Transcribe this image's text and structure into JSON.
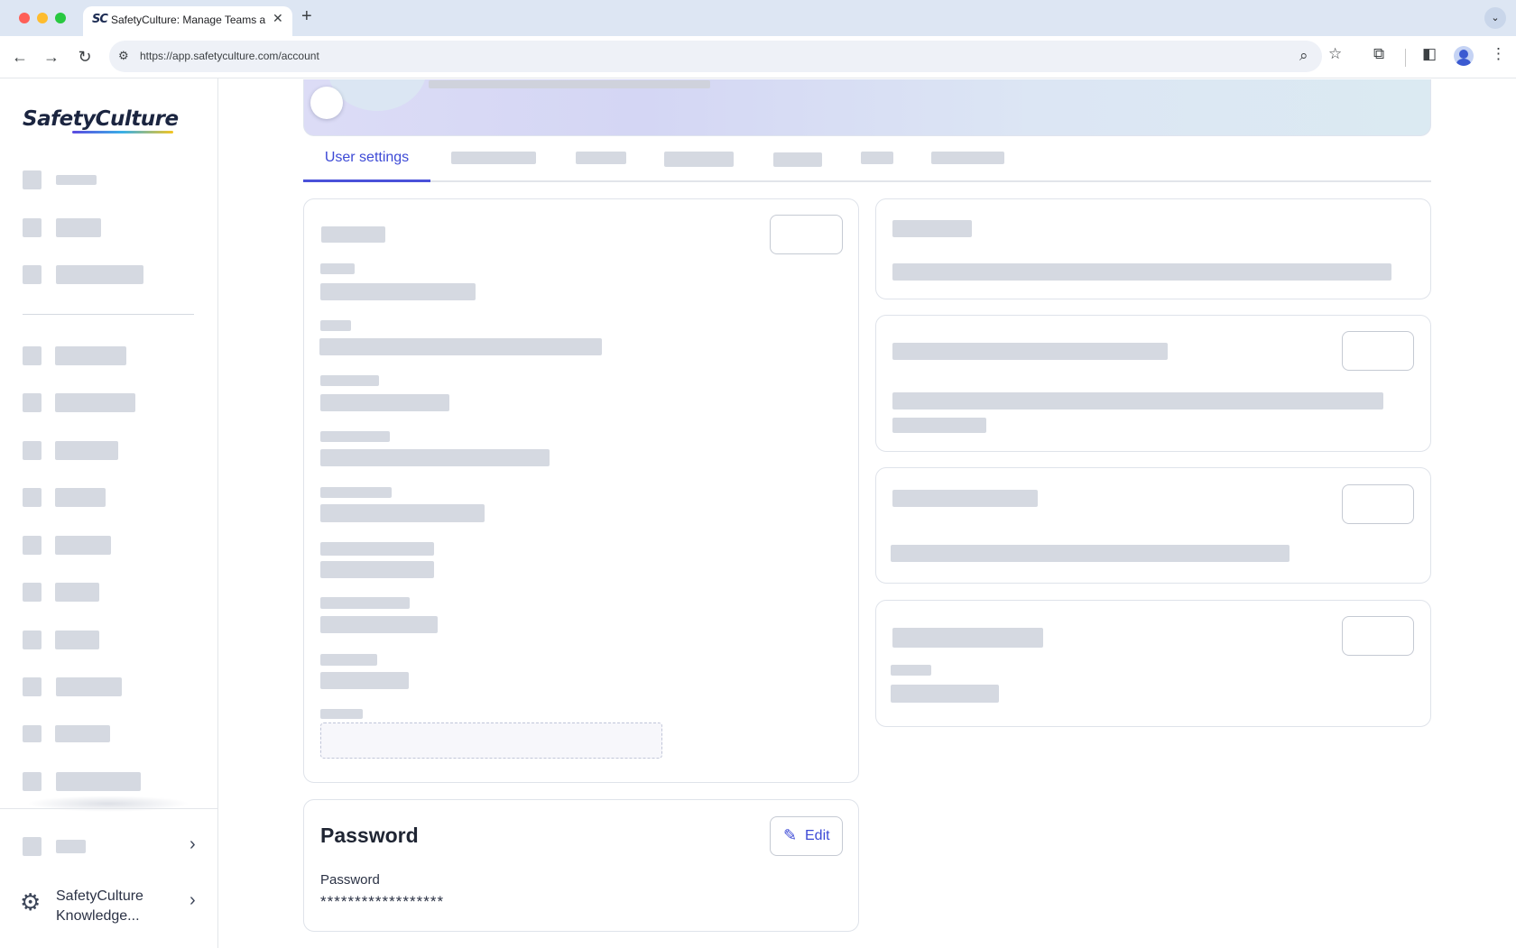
{
  "browser": {
    "tab_favicon": "SC",
    "tab_title": "SafetyCulture: Manage Teams and...",
    "tab_close": "✕",
    "new_tab": "+",
    "tab_menu": "⌄",
    "url": "https://app.safetyculture.com/account",
    "icons": [
      "back-icon",
      "forward-icon",
      "reload-icon",
      "site-settings-icon",
      "zoom-icon",
      "bookmark-star-icon",
      "extensions-icon",
      "side-panel-icon",
      "profile-icon",
      "more-vert-icon"
    ]
  },
  "sidebar": {
    "logo": "SafetyCulture",
    "bottom_item_label": "SafetyCulture Knowledge...",
    "icons": [
      "gear-icon",
      "chevron-right-icon"
    ]
  },
  "main": {
    "tabs": [
      {
        "label": "User settings",
        "active": true
      }
    ],
    "password_card": {
      "title": "Password",
      "edit_label": "Edit",
      "field_label": "Password",
      "field_value": "******************"
    }
  },
  "colors": {
    "accent": "#3d4ad6",
    "skeleton": "#d5d9e1",
    "chrome_bg": "#dde6f3"
  }
}
